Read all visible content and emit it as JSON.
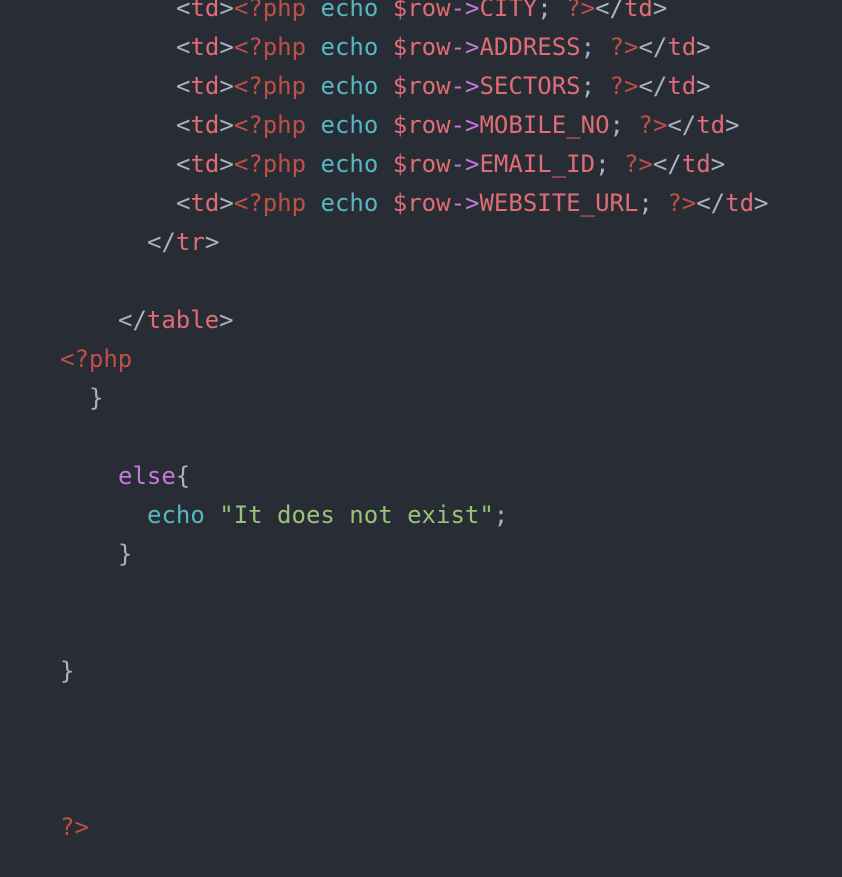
{
  "colors": {
    "background": "#282c34",
    "plain": "#abb2bf",
    "tag": "#e06c75",
    "php": "#be5046",
    "builtin": "#56b6c2",
    "operator": "#c678dd",
    "keyword": "#c678dd",
    "string": "#98c379"
  },
  "lines": [
    {
      "indent": "    ",
      "tokens": [
        {
          "t": "<",
          "c": "plain"
        },
        {
          "t": "td",
          "c": "tag"
        },
        {
          "t": ">",
          "c": "plain"
        },
        {
          "t": "<?php",
          "c": "php"
        },
        {
          "t": " ",
          "c": "plain"
        },
        {
          "t": "echo",
          "c": "builtin"
        },
        {
          "t": " ",
          "c": "plain"
        },
        {
          "t": "$row",
          "c": "tag"
        },
        {
          "t": "->",
          "c": "operator"
        },
        {
          "t": "CITY",
          "c": "tag"
        },
        {
          "t": "; ",
          "c": "plain"
        },
        {
          "t": "?>",
          "c": "php"
        },
        {
          "t": "</",
          "c": "plain"
        },
        {
          "t": "td",
          "c": "tag"
        },
        {
          "t": ">",
          "c": "plain"
        }
      ]
    },
    {
      "indent": "    ",
      "tokens": [
        {
          "t": "<",
          "c": "plain"
        },
        {
          "t": "td",
          "c": "tag"
        },
        {
          "t": ">",
          "c": "plain"
        },
        {
          "t": "<?php",
          "c": "php"
        },
        {
          "t": " ",
          "c": "plain"
        },
        {
          "t": "echo",
          "c": "builtin"
        },
        {
          "t": " ",
          "c": "plain"
        },
        {
          "t": "$row",
          "c": "tag"
        },
        {
          "t": "->",
          "c": "operator"
        },
        {
          "t": "ADDRESS",
          "c": "tag"
        },
        {
          "t": "; ",
          "c": "plain"
        },
        {
          "t": "?>",
          "c": "php"
        },
        {
          "t": "</",
          "c": "plain"
        },
        {
          "t": "td",
          "c": "tag"
        },
        {
          "t": ">",
          "c": "plain"
        }
      ]
    },
    {
      "indent": "    ",
      "tokens": [
        {
          "t": "<",
          "c": "plain"
        },
        {
          "t": "td",
          "c": "tag"
        },
        {
          "t": ">",
          "c": "plain"
        },
        {
          "t": "<?php",
          "c": "php"
        },
        {
          "t": " ",
          "c": "plain"
        },
        {
          "t": "echo",
          "c": "builtin"
        },
        {
          "t": " ",
          "c": "plain"
        },
        {
          "t": "$row",
          "c": "tag"
        },
        {
          "t": "->",
          "c": "operator"
        },
        {
          "t": "SECTORS",
          "c": "tag"
        },
        {
          "t": "; ",
          "c": "plain"
        },
        {
          "t": "?>",
          "c": "php"
        },
        {
          "t": "</",
          "c": "plain"
        },
        {
          "t": "td",
          "c": "tag"
        },
        {
          "t": ">",
          "c": "plain"
        }
      ]
    },
    {
      "indent": "    ",
      "tokens": [
        {
          "t": "<",
          "c": "plain"
        },
        {
          "t": "td",
          "c": "tag"
        },
        {
          "t": ">",
          "c": "plain"
        },
        {
          "t": "<?php",
          "c": "php"
        },
        {
          "t": " ",
          "c": "plain"
        },
        {
          "t": "echo",
          "c": "builtin"
        },
        {
          "t": " ",
          "c": "plain"
        },
        {
          "t": "$row",
          "c": "tag"
        },
        {
          "t": "->",
          "c": "operator"
        },
        {
          "t": "MOBILE_NO",
          "c": "tag"
        },
        {
          "t": "; ",
          "c": "plain"
        },
        {
          "t": "?>",
          "c": "php"
        },
        {
          "t": "</",
          "c": "plain"
        },
        {
          "t": "td",
          "c": "tag"
        },
        {
          "t": ">",
          "c": "plain"
        }
      ]
    },
    {
      "indent": "    ",
      "tokens": [
        {
          "t": "<",
          "c": "plain"
        },
        {
          "t": "td",
          "c": "tag"
        },
        {
          "t": ">",
          "c": "plain"
        },
        {
          "t": "<?php",
          "c": "php"
        },
        {
          "t": " ",
          "c": "plain"
        },
        {
          "t": "echo",
          "c": "builtin"
        },
        {
          "t": " ",
          "c": "plain"
        },
        {
          "t": "$row",
          "c": "tag"
        },
        {
          "t": "->",
          "c": "operator"
        },
        {
          "t": "EMAIL_ID",
          "c": "tag"
        },
        {
          "t": "; ",
          "c": "plain"
        },
        {
          "t": "?>",
          "c": "php"
        },
        {
          "t": "</",
          "c": "plain"
        },
        {
          "t": "td",
          "c": "tag"
        },
        {
          "t": ">",
          "c": "plain"
        }
      ]
    },
    {
      "indent": "    ",
      "tokens": [
        {
          "t": "<",
          "c": "plain"
        },
        {
          "t": "td",
          "c": "tag"
        },
        {
          "t": ">",
          "c": "plain"
        },
        {
          "t": "<?php",
          "c": "php"
        },
        {
          "t": " ",
          "c": "plain"
        },
        {
          "t": "echo",
          "c": "builtin"
        },
        {
          "t": " ",
          "c": "plain"
        },
        {
          "t": "$row",
          "c": "tag"
        },
        {
          "t": "->",
          "c": "operator"
        },
        {
          "t": "WEBSITE_URL",
          "c": "tag"
        },
        {
          "t": "; ",
          "c": "plain"
        },
        {
          "t": "?>",
          "c": "php"
        },
        {
          "t": "</",
          "c": "plain"
        },
        {
          "t": "td",
          "c": "tag"
        },
        {
          "t": ">",
          "c": "plain"
        }
      ]
    },
    {
      "indent": "   ",
      "tokens": [
        {
          "t": "</",
          "c": "plain"
        },
        {
          "t": "tr",
          "c": "tag"
        },
        {
          "t": ">",
          "c": "plain"
        }
      ]
    },
    {
      "indent": "",
      "tokens": []
    },
    {
      "indent": "  ",
      "tokens": [
        {
          "t": "</",
          "c": "plain"
        },
        {
          "t": "table",
          "c": "tag"
        },
        {
          "t": ">",
          "c": "plain"
        }
      ]
    },
    {
      "indent": "",
      "tokens": [
        {
          "t": "<?php",
          "c": "php"
        }
      ]
    },
    {
      "indent": " ",
      "tokens": [
        {
          "t": "}",
          "c": "plain"
        }
      ]
    },
    {
      "indent": "",
      "tokens": []
    },
    {
      "indent": "  ",
      "tokens": [
        {
          "t": "else",
          "c": "keyword"
        },
        {
          "t": "{",
          "c": "plain"
        }
      ]
    },
    {
      "indent": "   ",
      "tokens": [
        {
          "t": "echo",
          "c": "builtin"
        },
        {
          "t": " ",
          "c": "plain"
        },
        {
          "t": "\"It does not exist\"",
          "c": "string"
        },
        {
          "t": ";",
          "c": "plain"
        }
      ]
    },
    {
      "indent": "  ",
      "tokens": [
        {
          "t": "}",
          "c": "plain"
        }
      ]
    },
    {
      "indent": "",
      "tokens": []
    },
    {
      "indent": "",
      "tokens": []
    },
    {
      "indent": "",
      "tokens": [
        {
          "t": "}",
          "c": "plain"
        }
      ]
    },
    {
      "indent": "",
      "tokens": []
    },
    {
      "indent": "",
      "tokens": []
    },
    {
      "indent": "",
      "tokens": []
    },
    {
      "indent": "",
      "tokens": [
        {
          "t": "?>",
          "c": "php"
        }
      ]
    }
  ]
}
